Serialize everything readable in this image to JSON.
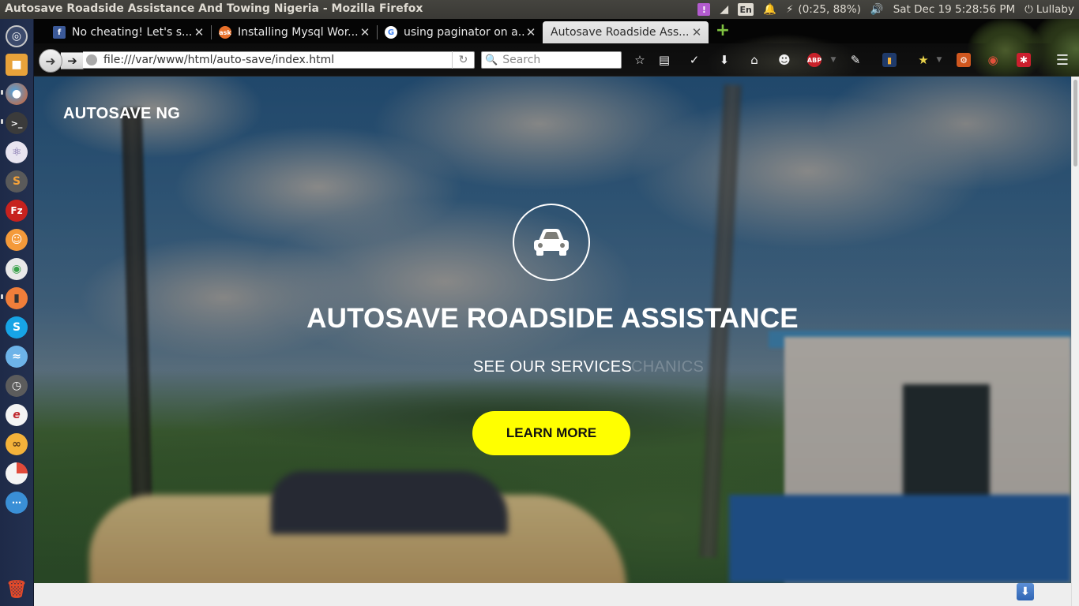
{
  "os_panel": {
    "window_title": "Autosave Roadside Assistance And Towing Nigeria - Mozilla Firefox",
    "keyboard_layout": "En",
    "battery": "(0:25, 88%)",
    "datetime": "Sat Dec 19  5:28:56 PM",
    "music_player": "Lullaby"
  },
  "launcher": {
    "apps": [
      "ubuntu-dash",
      "files",
      "firefox",
      "terminal",
      "atom",
      "sublime-text",
      "filezilla",
      "ubuntu-software",
      "settings-toggle",
      "media-player",
      "skype",
      "messenger",
      "clock",
      "text-editor",
      "vlc",
      "chart-app",
      "more-apps"
    ],
    "trash": "trash"
  },
  "browser": {
    "tabs": [
      {
        "label": "No cheating! Let's s...",
        "favicon": "facebook",
        "active": false
      },
      {
        "label": "Installing Mysql Wor...",
        "favicon": "askubuntu",
        "active": false
      },
      {
        "label": "using paginator on a...",
        "favicon": "google",
        "active": false
      },
      {
        "label": "Autosave Roadside Ass...",
        "favicon": "none",
        "active": true
      }
    ],
    "url": "file:///var/www/html/auto-save/index.html",
    "search_placeholder": "Search",
    "toolbar_icons": [
      "bookmark-star",
      "reading-list",
      "pocket",
      "downloads",
      "home",
      "chat",
      "adblock-plus",
      "pen",
      "analytics",
      "idea",
      "ubuntu-one",
      "lock",
      "lastpass",
      "menu"
    ]
  },
  "page": {
    "brand": "AUTOSAVE NG",
    "hero_icon": "car-icon",
    "hero_title": "AUTOSAVE ROADSIDE ASSISTANCE",
    "hero_subtitle": "SEE OUR SERVICES",
    "hero_subtitle_fading": "CHANICS",
    "cta_label": "LEARN MORE",
    "cta_color": "#ffff00"
  }
}
